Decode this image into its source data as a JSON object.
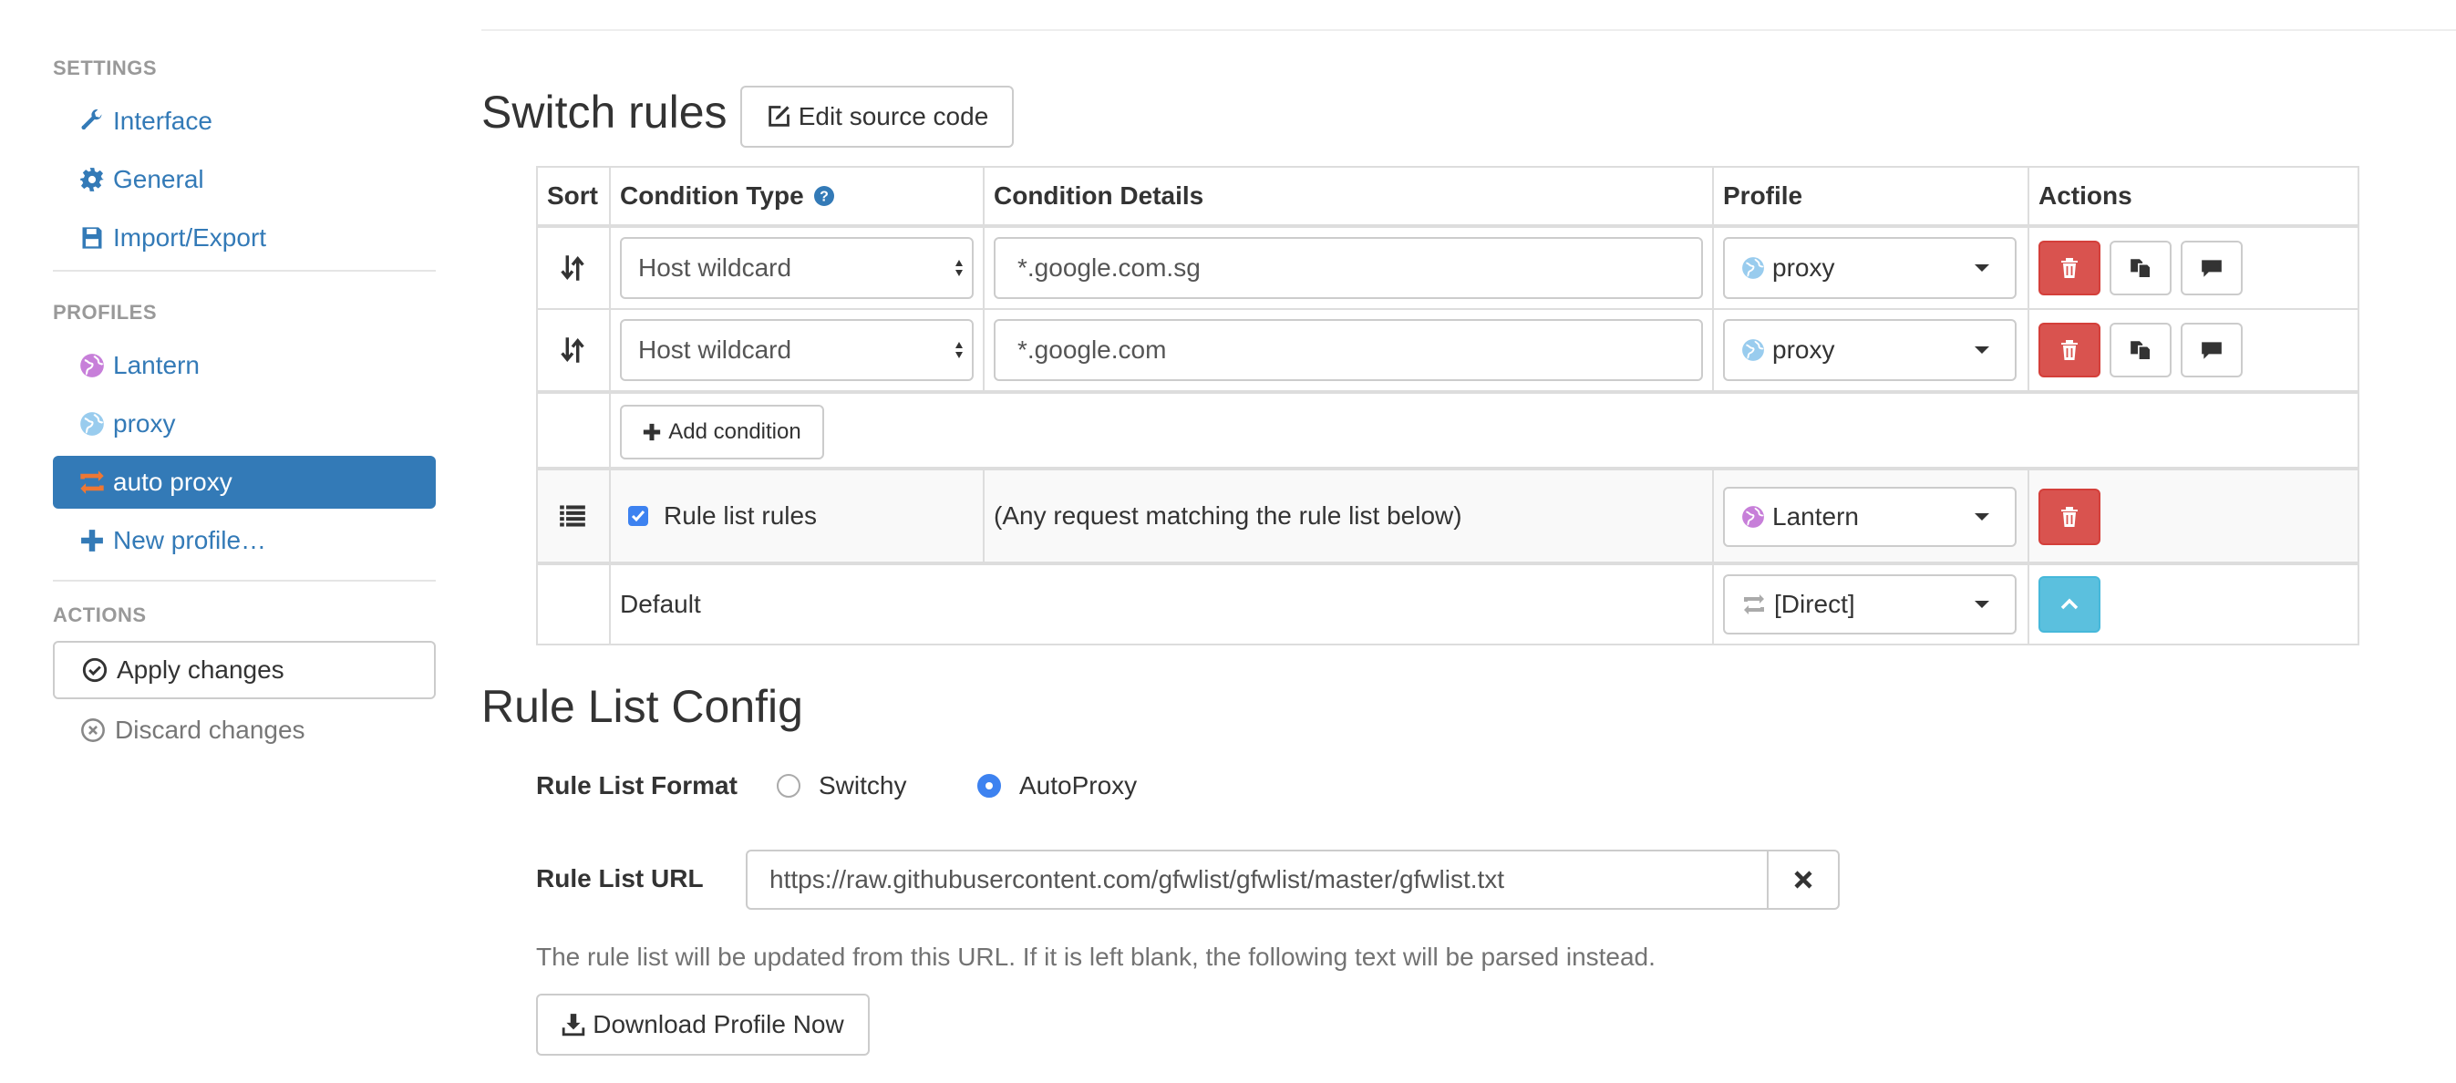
{
  "sidebar": {
    "settings_header": "SETTINGS",
    "settings_items": [
      {
        "label": "Interface",
        "icon": "wrench-icon"
      },
      {
        "label": "General",
        "icon": "gear-icon"
      },
      {
        "label": "Import/Export",
        "icon": "floppy-icon"
      }
    ],
    "profiles_header": "PROFILES",
    "profile_items": [
      {
        "label": "Lantern",
        "icon": "globe-icon",
        "color": "#c77fd9"
      },
      {
        "label": "proxy",
        "icon": "globe-icon",
        "color": "#99ccee"
      },
      {
        "label": "auto proxy",
        "icon": "switch-icon",
        "color": "#ee7733",
        "active": true
      },
      {
        "label": "New profile…",
        "icon": "plus-icon"
      }
    ],
    "actions_header": "ACTIONS",
    "apply_label": "Apply changes",
    "discard_label": "Discard changes"
  },
  "switch_rules": {
    "title": "Switch rules",
    "edit_source_label": "Edit source code",
    "columns": {
      "sort": "Sort",
      "condition_type": "Condition Type",
      "condition_details": "Condition Details",
      "profile": "Profile",
      "actions": "Actions"
    },
    "rows": [
      {
        "condition_type": "Host wildcard",
        "condition_details": "*.google.com.sg",
        "profile": "proxy"
      },
      {
        "condition_type": "Host wildcard",
        "condition_details": "*.google.com",
        "profile": "proxy"
      }
    ],
    "add_condition_label": "Add condition",
    "rule_list_row": {
      "label": "Rule list rules",
      "checked": true,
      "details": "(Any request matching the rule list below)",
      "profile": "Lantern"
    },
    "default_row": {
      "label": "Default",
      "profile": "[Direct]"
    }
  },
  "rule_list_config": {
    "title": "Rule List Config",
    "format_label": "Rule List Format",
    "format_options": [
      {
        "label": "Switchy",
        "selected": false
      },
      {
        "label": "AutoProxy",
        "selected": true
      }
    ],
    "url_label": "Rule List URL",
    "url_value": "https://raw.githubusercontent.com/gfwlist/gfwlist/master/gfwlist.txt",
    "help_text": "The rule list will be updated from this URL. If it is left blank, the following text will be parsed instead.",
    "download_label": "Download Profile Now"
  },
  "colors": {
    "link": "#337ab7",
    "active_bg": "#337ab7",
    "danger": "#d9534f",
    "info": "#5bc0de",
    "radio_selected": "#3d82f0"
  }
}
